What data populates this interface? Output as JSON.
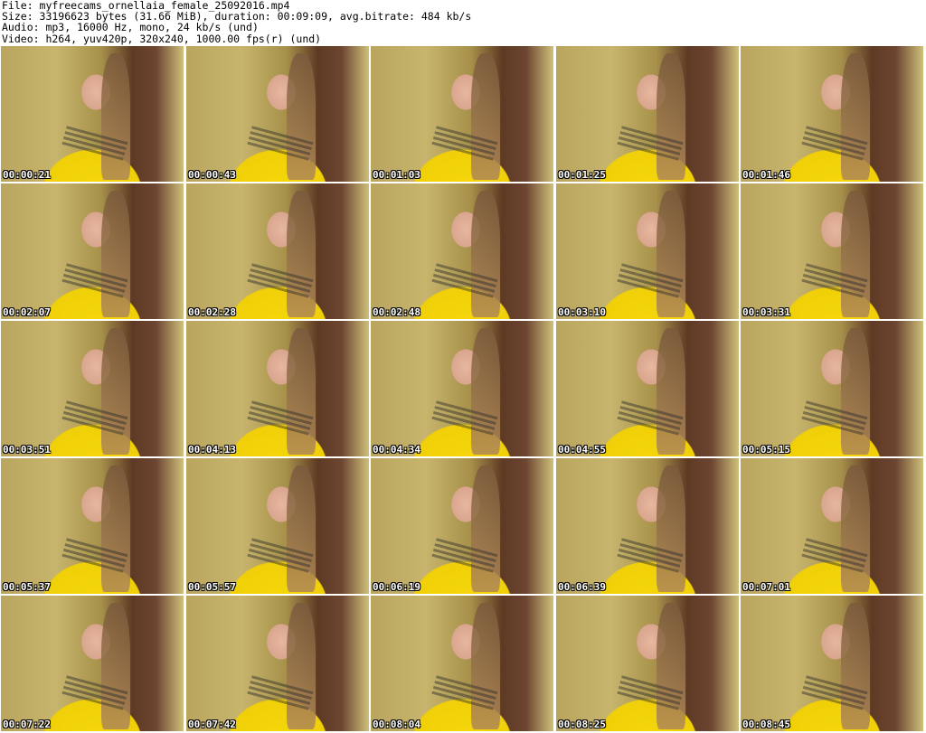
{
  "header": {
    "file_line": "File: myfreecams_ornellaia_female_25092016.mp4",
    "size_line": "Size: 33196623 bytes (31.66 MiB), duration: 00:09:09, avg.bitrate: 484 kb/s",
    "audio_line": "Audio: mp3, 16000 Hz, mono, 24 kb/s (und)",
    "video_line": "Video: h264, yuv420p, 320x240, 1000.00 fps(r) (und)"
  },
  "thumbnails": [
    "00:00:21",
    "00:00:43",
    "00:01:03",
    "00:01:25",
    "00:01:46",
    "00:02:07",
    "00:02:28",
    "00:02:48",
    "00:03:10",
    "00:03:31",
    "00:03:51",
    "00:04:13",
    "00:04:34",
    "00:04:55",
    "00:05:15",
    "00:05:37",
    "00:05:57",
    "00:06:19",
    "00:06:39",
    "00:07:01",
    "00:07:22",
    "00:07:42",
    "00:08:04",
    "00:08:25",
    "00:08:45"
  ]
}
